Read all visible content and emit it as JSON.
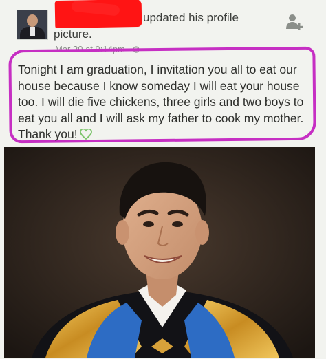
{
  "post": {
    "header_text_1": "updated his profile",
    "header_text_2": "picture.",
    "timestamp": "Mar 20 at 9:14pm",
    "privacy_icon": "public-globe-icon",
    "add_friend_icon": "add-friend-icon",
    "body": "Tonight I am graduation, I invitation you all to eat our house because I know someday I will eat your house too. I will die five chickens, three girls and two boys to eat you all and I will ask my father to cook my mother. Thank you!",
    "reaction_icon": "green-heart-icon"
  },
  "colors": {
    "highlight": "#c62fc3",
    "redaction": "#ff1414",
    "heart": "#7cc46b"
  }
}
